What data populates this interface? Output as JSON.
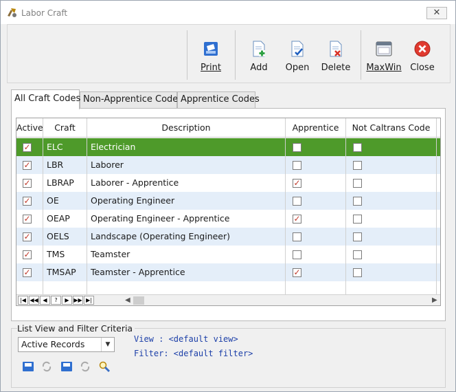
{
  "window": {
    "title": "Labor Craft",
    "close_glyph": "✕"
  },
  "toolbar": {
    "buttons": [
      {
        "id": "print",
        "label": "Print",
        "icon": "printer-icon"
      },
      {
        "id": "add",
        "label": "Add",
        "icon": "add-document-icon"
      },
      {
        "id": "open",
        "label": "Open",
        "icon": "open-document-icon"
      },
      {
        "id": "delete",
        "label": "Delete",
        "icon": "delete-document-icon"
      },
      {
        "id": "maxwin",
        "label": "MaxWin",
        "icon": "maximize-window-icon"
      },
      {
        "id": "close",
        "label": "Close",
        "icon": "close-circle-icon"
      }
    ]
  },
  "tabs": [
    {
      "label": "All Craft Codes",
      "active": true
    },
    {
      "label": "Non-Apprentice Codes",
      "active": false
    },
    {
      "label": "Apprentice Codes",
      "active": false
    }
  ],
  "grid": {
    "columns": [
      "Active",
      "Craft",
      "Description",
      "Apprentice",
      "Not Caltrans Code"
    ],
    "rows": [
      {
        "active": true,
        "craft": "ELC",
        "description": "Electrician",
        "apprentice": false,
        "not_caltrans": false,
        "selected": true
      },
      {
        "active": true,
        "craft": "LBR",
        "description": "Laborer",
        "apprentice": false,
        "not_caltrans": false
      },
      {
        "active": true,
        "craft": "LBRAP",
        "description": "Laborer - Apprentice",
        "apprentice": true,
        "not_caltrans": false
      },
      {
        "active": true,
        "craft": "OE",
        "description": "Operating Engineer",
        "apprentice": false,
        "not_caltrans": false
      },
      {
        "active": true,
        "craft": "OEAP",
        "description": "Operating Engineer - Apprentice",
        "apprentice": true,
        "not_caltrans": false
      },
      {
        "active": true,
        "craft": "OELS",
        "description": "Landscape (Operating Engineer)",
        "apprentice": false,
        "not_caltrans": false
      },
      {
        "active": true,
        "craft": "TMS",
        "description": "Teamster",
        "apprentice": false,
        "not_caltrans": false
      },
      {
        "active": true,
        "craft": "TMSAP",
        "description": "Teamster - Apprentice",
        "apprentice": true,
        "not_caltrans": false
      }
    ],
    "nav_buttons": [
      "|◀",
      "◀◀",
      "◀",
      "?",
      "▶",
      "▶▶",
      "▶|"
    ]
  },
  "filter": {
    "section_title": "List View and Filter Criteria",
    "selected_option": "Active Records",
    "view_line": "View  : <default view>",
    "filter_line": "Filter: <default filter>"
  },
  "colors": {
    "selected_row": "#4e9a2a",
    "alt_row": "#e4eef9",
    "check_mark": "#c0392b"
  }
}
